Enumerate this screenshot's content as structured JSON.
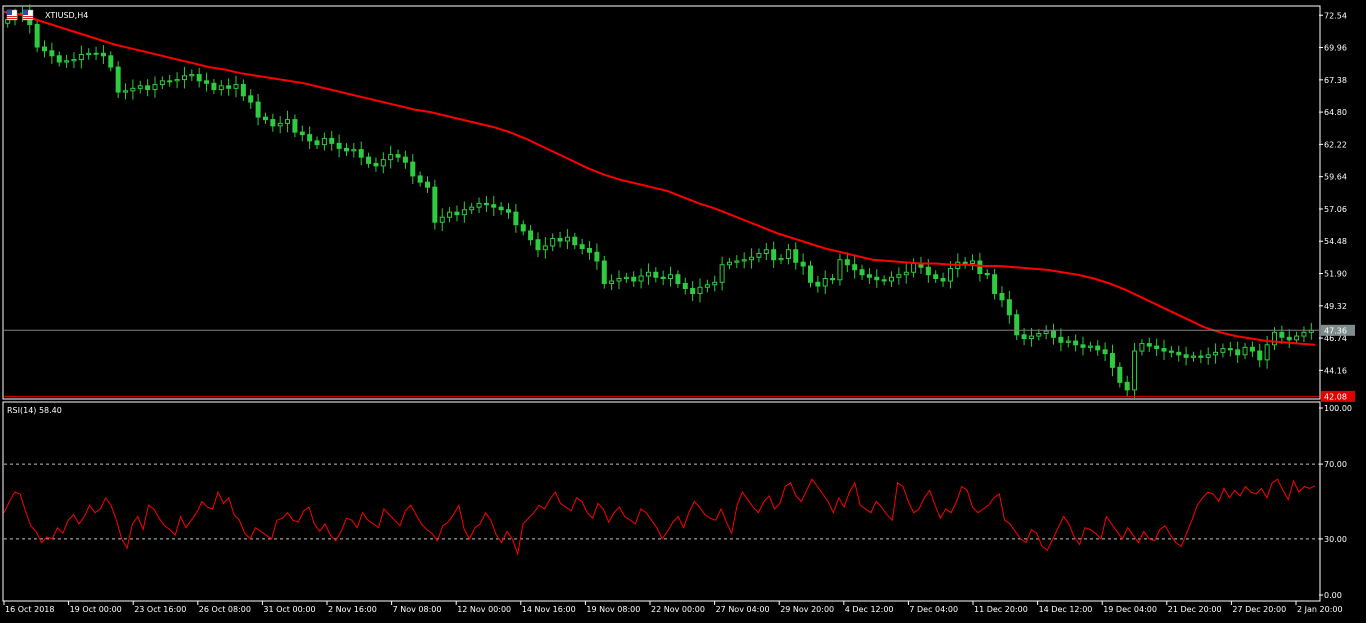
{
  "window": {
    "symbol_label": "XTIUSD,H4",
    "flag_icon": "us-flag-icon"
  },
  "colors": {
    "background": "#000000",
    "grid_frame": "#ffffff",
    "candle_up": "#2ecc40",
    "candle_down": "#2ecc40",
    "ma_line": "#ff0000",
    "rsi_line": "#ff0000",
    "price_line": "#808080",
    "price_label_bg": "#7f8c8d",
    "red_level_bg": "#e00000",
    "rsi_level_line": "#c0c0c0"
  },
  "chart_data": [
    {
      "type": "line",
      "title": "XTIUSD,H4",
      "description": "Candlestick price chart with moving average (red)",
      "y_ticks": [
        "72.54",
        "69.96",
        "67.38",
        "64.80",
        "62.22",
        "59.64",
        "57.06",
        "54.48",
        "51.90",
        "49.32",
        "46.74",
        "44.16"
      ],
      "ylim": [
        41.95,
        73.2
      ],
      "current_price_label": "47.36",
      "current_price": 47.36,
      "red_level_label": "42.08",
      "red_level": 42.08,
      "x_tick_labels": [
        "16 Oct 2018",
        "19 Oct 00:00",
        "23 Oct 16:00",
        "26 Oct 08:00",
        "31 Oct 00:00",
        "2 Nov 16:00",
        "7 Nov 08:00",
        "12 Nov 00:00",
        "14 Nov 16:00",
        "19 Nov 08:00",
        "22 Nov 00:00",
        "27 Nov 04:00",
        "29 Nov 20:00",
        "4 Dec 12:00",
        "7 Dec 04:00",
        "11 Dec 20:00",
        "14 Dec 12:00",
        "19 Dec 04:00",
        "21 Dec 20:00",
        "27 Dec 20:00",
        "2 Jan 20:00"
      ],
      "series": [
        {
          "name": "",
          "style": "candles",
          "close": [
            72.2,
            72.6,
            72.7,
            71.8,
            70.0,
            69.7,
            69.3,
            68.8,
            68.9,
            69.0,
            69.4,
            69.5,
            69.5,
            69.3,
            68.4,
            66.4,
            66.5,
            66.7,
            66.9,
            66.6,
            67.0,
            67.3,
            67.3,
            67.4,
            67.7,
            67.8,
            67.3,
            67.1,
            66.6,
            66.9,
            66.7,
            67.0,
            66.1,
            65.6,
            64.4,
            64.2,
            63.7,
            63.9,
            64.2,
            63.2,
            63.0,
            62.5,
            62.2,
            62.7,
            62.3,
            61.9,
            61.7,
            61.8,
            61.2,
            60.7,
            60.5,
            61.0,
            61.4,
            61.2,
            60.8,
            59.7,
            59.2,
            58.8,
            56.0,
            56.4,
            56.8,
            56.6,
            57.0,
            57.2,
            57.5,
            57.4,
            57.2,
            57.0,
            56.8,
            55.8,
            55.3,
            54.6,
            53.8,
            54.1,
            54.7,
            54.5,
            54.8,
            54.2,
            53.9,
            53.6,
            52.9,
            51.1,
            51.3,
            51.5,
            51.6,
            51.3,
            51.7,
            52.0,
            51.6,
            51.5,
            51.8,
            51.1,
            50.7,
            50.3,
            50.8,
            51.0,
            51.2,
            52.6,
            52.8,
            52.9,
            53.0,
            53.2,
            53.5,
            53.8,
            53.0,
            53.1,
            53.8,
            52.8,
            52.5,
            51.2,
            50.9,
            51.5,
            51.4,
            53.0,
            52.6,
            52.2,
            51.8,
            51.6,
            51.4,
            51.3,
            51.6,
            51.8,
            52.0,
            52.7,
            52.4,
            51.8,
            51.5,
            51.3,
            52.3,
            52.8,
            52.7,
            52.9,
            51.9,
            51.8,
            50.3,
            49.8,
            48.6,
            47.0,
            46.7,
            46.9,
            47.1,
            47.3,
            46.8,
            46.4,
            46.5,
            46.2,
            46.0,
            46.1,
            45.8,
            45.5,
            44.4,
            43.2,
            42.6,
            45.7,
            46.3,
            46.1,
            45.9,
            45.7,
            45.6,
            45.4,
            45.2,
            45.3,
            45.2,
            45.4,
            45.6,
            45.9,
            45.8,
            45.4,
            46.0,
            45.7,
            45.0,
            46.2,
            47.2,
            46.8,
            46.6,
            46.9,
            47.2,
            47.36
          ],
          "values_note": "closes read approximately from the chart"
        },
        {
          "name": "",
          "style": "line",
          "values": [
            72.8,
            72.6,
            72.2,
            71.8,
            71.4,
            71.0,
            70.6,
            70.2,
            69.9,
            69.6,
            69.3,
            69.0,
            68.7,
            68.4,
            68.2,
            67.9,
            67.7,
            67.5,
            67.3,
            67.1,
            66.8,
            66.5,
            66.2,
            65.9,
            65.6,
            65.3,
            65.0,
            64.8,
            64.5,
            64.2,
            63.9,
            63.6,
            63.2,
            62.7,
            62.1,
            61.5,
            60.9,
            60.3,
            59.8,
            59.4,
            59.1,
            58.8,
            58.5,
            58.0,
            57.5,
            57.1,
            56.6,
            56.1,
            55.6,
            55.1,
            54.7,
            54.3,
            53.9,
            53.6,
            53.3,
            53.0,
            52.9,
            52.8,
            52.7,
            52.7,
            52.6,
            52.6,
            52.5,
            52.5,
            52.4,
            52.3,
            52.2,
            52.0,
            51.8,
            51.5,
            51.1,
            50.6,
            50.0,
            49.4,
            48.8,
            48.2,
            47.6,
            47.2,
            46.9,
            46.7,
            46.5,
            46.4,
            46.3,
            46.2
          ]
        }
      ]
    },
    {
      "type": "line",
      "title": "RSI(14) 58.40",
      "y_ticks": [
        "100.00",
        "70.00",
        "30.00",
        "0.00"
      ],
      "ylim": [
        0,
        100
      ],
      "levels": [
        70,
        30
      ],
      "series": [
        {
          "name": "RSI(14)",
          "values": [
            44,
            50,
            55,
            54,
            45,
            37,
            34,
            28,
            31,
            30,
            36,
            33,
            40,
            43,
            38,
            42,
            48,
            44,
            46,
            52,
            48,
            40,
            30,
            25,
            38,
            42,
            35,
            48,
            46,
            41,
            37,
            35,
            32,
            42,
            36,
            40,
            44,
            50,
            47,
            46,
            55,
            49,
            52,
            43,
            40,
            33,
            30,
            36,
            34,
            32,
            30,
            40,
            41,
            44,
            40,
            39,
            45,
            47,
            38,
            34,
            38,
            32,
            29,
            34,
            41,
            40,
            36,
            44,
            40,
            38,
            36,
            46,
            43,
            40,
            37,
            45,
            48,
            43,
            38,
            35,
            33,
            29,
            37,
            39,
            43,
            48,
            35,
            30,
            36,
            38,
            44,
            40,
            32,
            28,
            34,
            30,
            22,
            38,
            41,
            44,
            48,
            46,
            51,
            55,
            49,
            47,
            45,
            52,
            50,
            44,
            41,
            49,
            46,
            39,
            44,
            47,
            42,
            40,
            38,
            46,
            44,
            40,
            36,
            30,
            34,
            39,
            42,
            36,
            44,
            50,
            47,
            43,
            41,
            40,
            46,
            39,
            33,
            48,
            55,
            51,
            47,
            44,
            50,
            53,
            46,
            49,
            58,
            60,
            53,
            50,
            56,
            62,
            58,
            54,
            50,
            44,
            52,
            47,
            55,
            60,
            48,
            46,
            44,
            50,
            47,
            43,
            40,
            60,
            58,
            50,
            44,
            46,
            52,
            56,
            48,
            41,
            46,
            44,
            50,
            58,
            56,
            47,
            44,
            46,
            48,
            52,
            54,
            40,
            38,
            34,
            30,
            28,
            35,
            33,
            26,
            24,
            30,
            36,
            42,
            38,
            31,
            27,
            36,
            35,
            33,
            30,
            42,
            38,
            34,
            30,
            36,
            32,
            28,
            34,
            30,
            29,
            35,
            37,
            32,
            28,
            26,
            33,
            40,
            48,
            52,
            55,
            54,
            50,
            57,
            52,
            56,
            53,
            58,
            55,
            54,
            57,
            52,
            60,
            62,
            56,
            51,
            61,
            55,
            58,
            57,
            58.4
          ]
        }
      ]
    }
  ]
}
